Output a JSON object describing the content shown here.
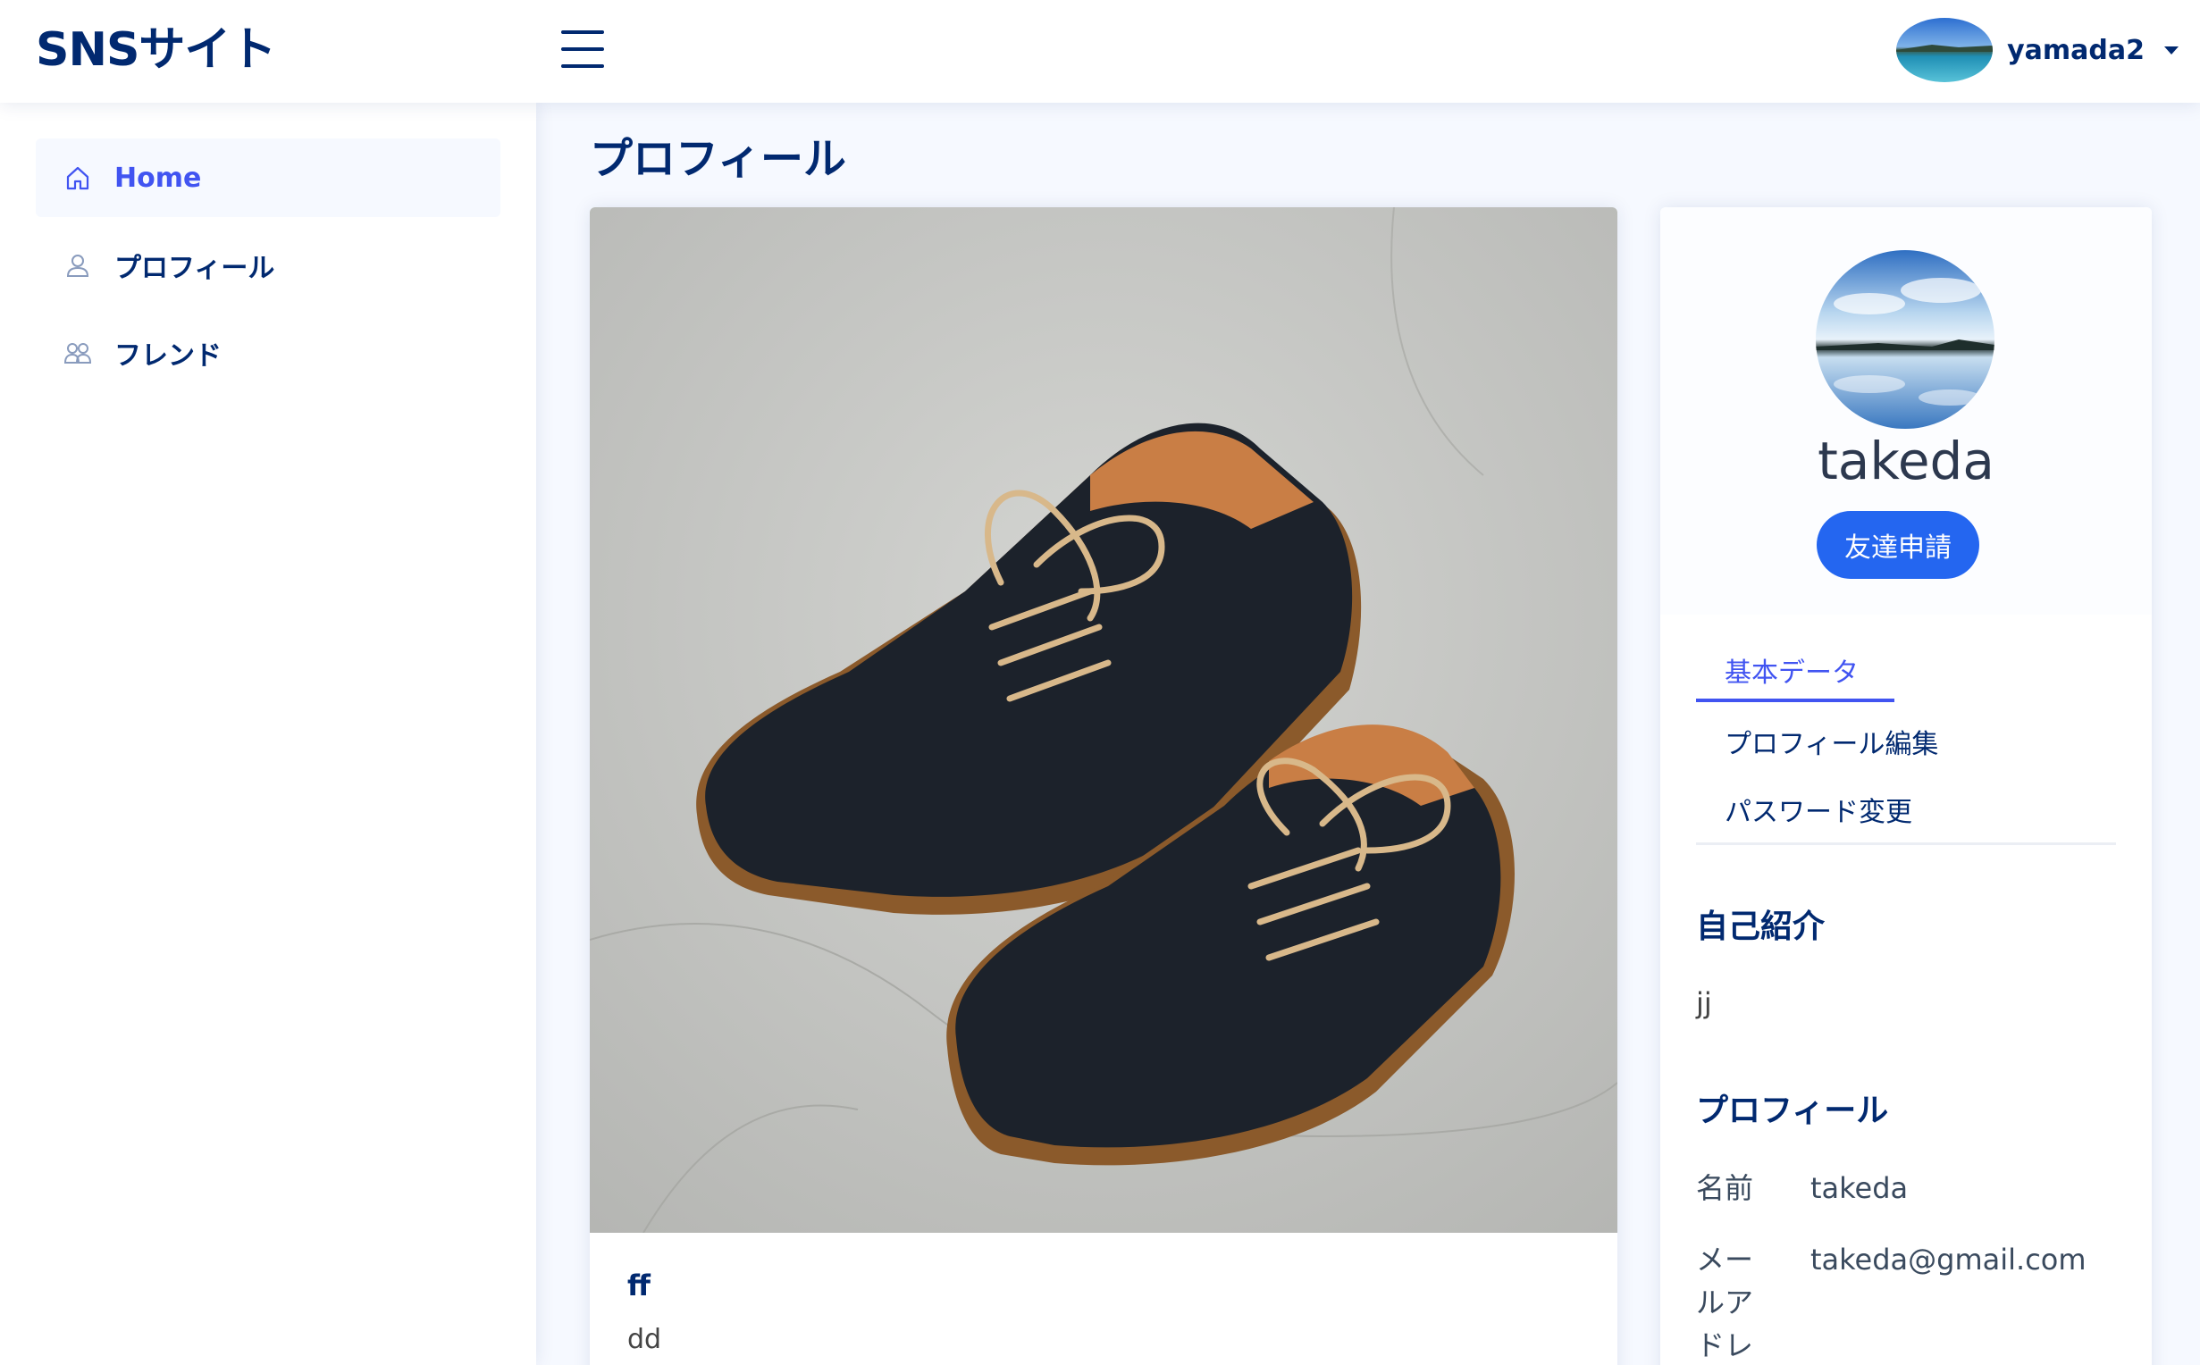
{
  "header": {
    "logo": "SNSサイト",
    "username": "yamada2"
  },
  "sidebar": {
    "items": [
      {
        "label": "Home",
        "icon": "home-icon",
        "active": true
      },
      {
        "label": "プロフィール",
        "icon": "person-icon",
        "active": false
      },
      {
        "label": "フレンド",
        "icon": "people-icon",
        "active": false
      }
    ]
  },
  "main": {
    "page_title": "プロフィール",
    "post": {
      "title": "ff",
      "body": "dd"
    }
  },
  "profile": {
    "name": "takeda",
    "friend_request_label": "友達申請",
    "tabs": [
      {
        "label": "基本データ",
        "active": true
      },
      {
        "label": "プロフィール編集",
        "active": false
      },
      {
        "label": "パスワード変更",
        "active": false
      }
    ],
    "bio_heading": "自己紹介",
    "bio": "jj",
    "details_heading": "プロフィール",
    "details": {
      "name_label": "名前",
      "name_value": "takeda",
      "email_label": "メールアドレ",
      "email_value": "takeda@gmail.com"
    }
  },
  "colors": {
    "primary_text": "#012970",
    "accent": "#4154f1",
    "button": "#2466f0",
    "background": "#f6f9ff"
  }
}
